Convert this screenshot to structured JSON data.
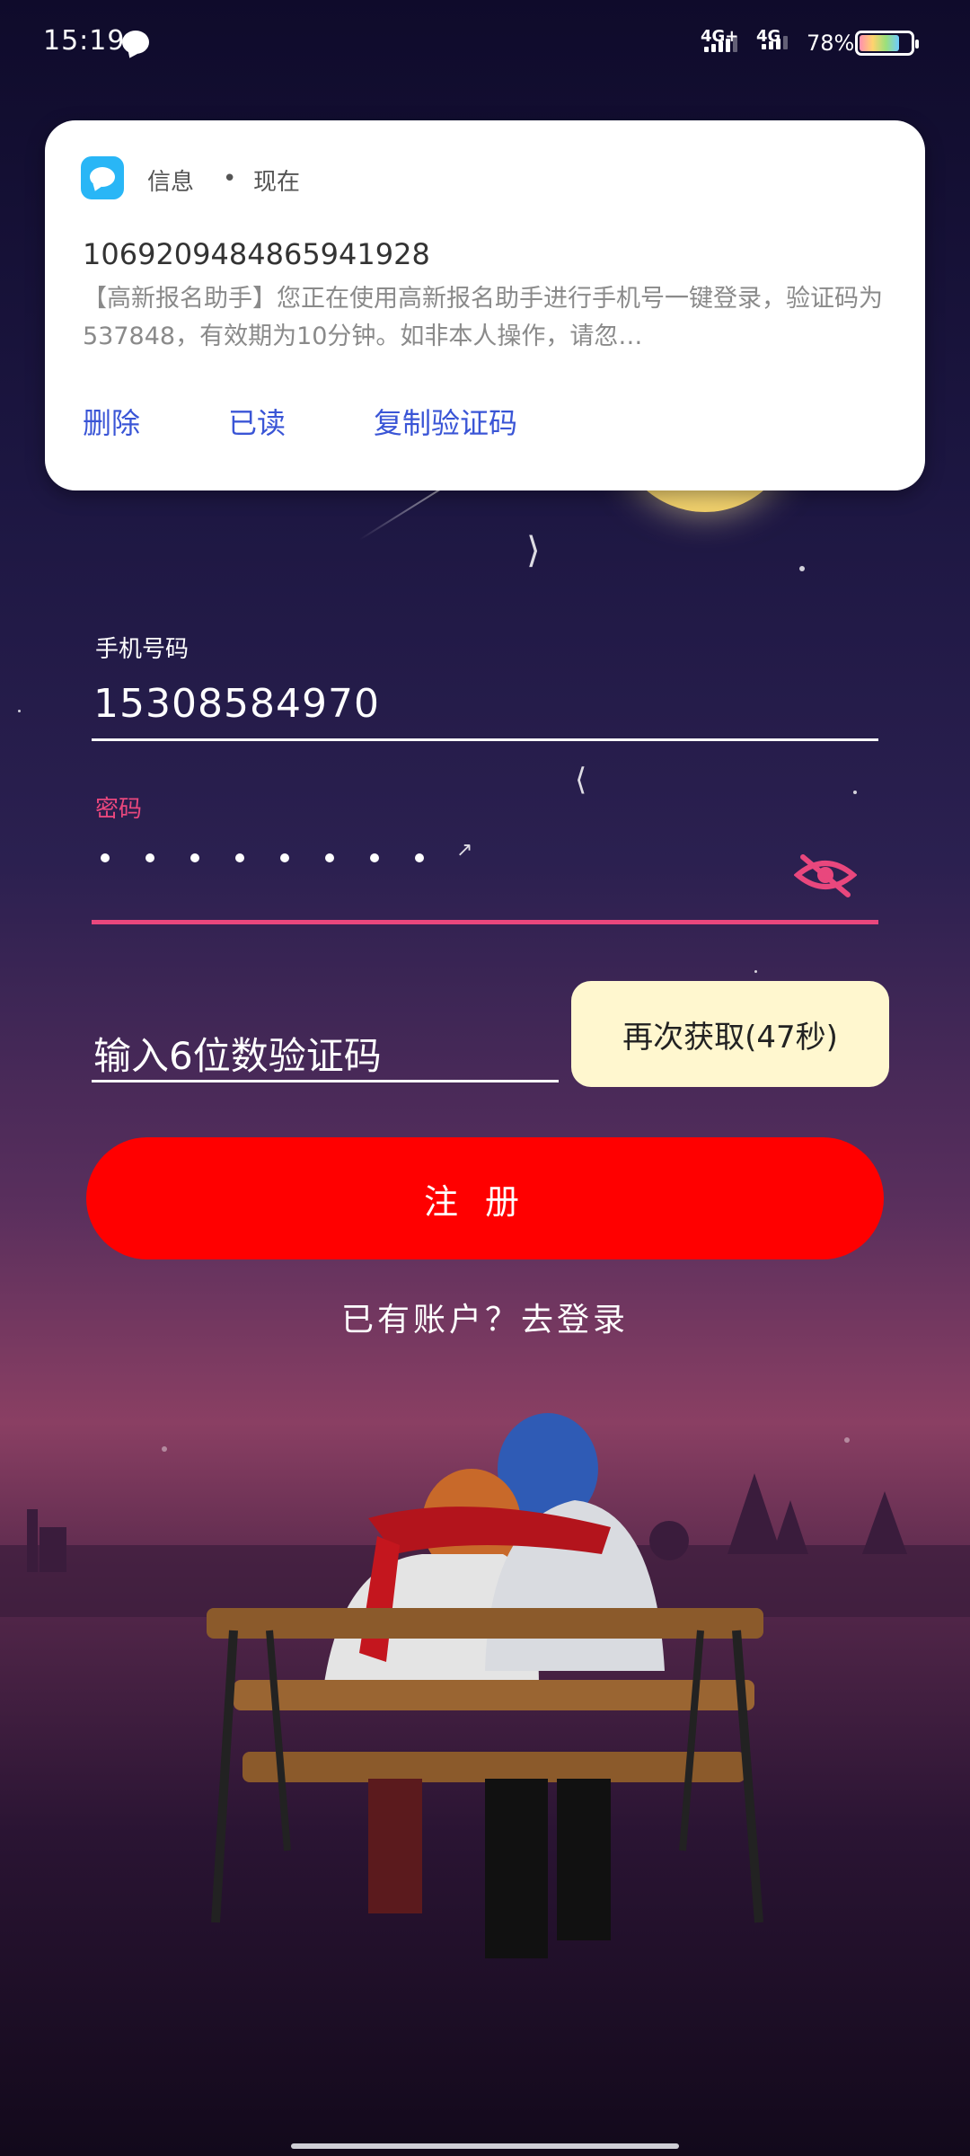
{
  "status_bar": {
    "time": "15:19",
    "network1": "4G+",
    "network2": "4G",
    "battery": "78%"
  },
  "notification": {
    "app": "信息",
    "separator": "•",
    "when": "现在",
    "sender": "1069209484865941928",
    "body": "【高新报名助手】您正在使用高新报名助手进行手机号一键登录，验证码为537848，有效期为10分钟。如非本人操作，请忽…",
    "actions": [
      "删除",
      "已读",
      "复制验证码"
    ]
  },
  "form": {
    "phone_label": "手机号码",
    "phone_value": "15308584970",
    "password_label": "密码",
    "code_placeholder": "输入6位数验证码",
    "resend_label": "再次获取(47秒)",
    "register_label": "注册",
    "login_link": "已有账户？去登录"
  },
  "colors": {
    "accent": "#e9477d",
    "register_button": "#ff0000",
    "resend_bg": "#fff7cf",
    "link": "#3a55d6"
  }
}
